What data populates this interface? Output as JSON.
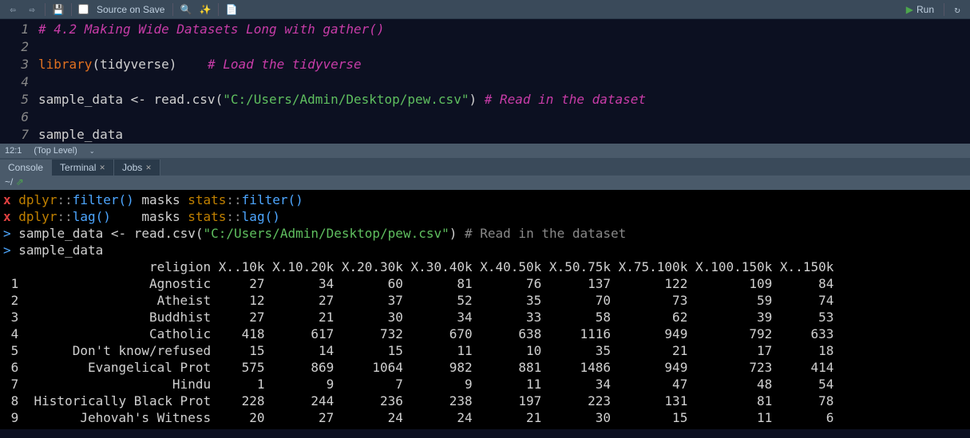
{
  "toolbar": {
    "source_on_save": "Source on Save",
    "run": "Run"
  },
  "editor": {
    "lines": [
      "1",
      "2",
      "3",
      "4",
      "5",
      "6",
      "7"
    ],
    "code": {
      "l1": "# 4.2 Making Wide Datasets Long with gather()",
      "l3_lib": "library",
      "l3_arg": "tidyverse",
      "l3_com": "# Load the tidyverse",
      "l5_var": "sample_data",
      "l5_op": " <- ",
      "l5_fn": "read.csv",
      "l5_str": "\"C:/Users/Admin/Desktop/pew.csv\"",
      "l5_com": "# Read in the dataset",
      "l7": "sample_data"
    }
  },
  "status": {
    "pos": "12:1",
    "scope": "(Top Level)"
  },
  "tabs": {
    "console": "Console",
    "terminal": "Terminal",
    "jobs": "Jobs"
  },
  "console_dir": "~/",
  "console": {
    "m0_pkg1": "dplyr",
    "m0_fn1": "filter()",
    "m0_masks": "masks",
    "m0_pkg2": "stats",
    "m0_fn2": "filter()",
    "m1_pkg1": "dplyr",
    "m1_fn1": "lag()",
    "m1_masks": "masks",
    "m1_pkg2": "stats",
    "m1_fn2": "lag()",
    "prompt": ">",
    "cmd1_var": "sample_data",
    "cmd1_op": " <- ",
    "cmd1_fn": "read.csv",
    "cmd1_str": "\"C:/Users/Admin/Desktop/pew.csv\"",
    "cmd1_com": "# Read in the dataset",
    "cmd2": "sample_data"
  },
  "chart_data": {
    "type": "table",
    "columns": [
      "religion",
      "X..10k",
      "X.10.20k",
      "X.20.30k",
      "X.30.40k",
      "X.40.50k",
      "X.50.75k",
      "X.75.100k",
      "X.100.150k",
      "X..150k"
    ],
    "rows": [
      {
        "n": "1",
        "religion": "Agnostic",
        "v": [
          27,
          34,
          60,
          81,
          76,
          137,
          122,
          109,
          84
        ]
      },
      {
        "n": "2",
        "religion": "Atheist",
        "v": [
          12,
          27,
          37,
          52,
          35,
          70,
          73,
          59,
          74
        ]
      },
      {
        "n": "3",
        "religion": "Buddhist",
        "v": [
          27,
          21,
          30,
          34,
          33,
          58,
          62,
          39,
          53
        ]
      },
      {
        "n": "4",
        "religion": "Catholic",
        "v": [
          418,
          617,
          732,
          670,
          638,
          1116,
          949,
          792,
          633
        ]
      },
      {
        "n": "5",
        "religion": "Don't know/refused",
        "v": [
          15,
          14,
          15,
          11,
          10,
          35,
          21,
          17,
          18
        ]
      },
      {
        "n": "6",
        "religion": "Evangelical Prot",
        "v": [
          575,
          869,
          1064,
          982,
          881,
          1486,
          949,
          723,
          414
        ]
      },
      {
        "n": "7",
        "religion": "Hindu",
        "v": [
          1,
          9,
          7,
          9,
          11,
          34,
          47,
          48,
          54
        ]
      },
      {
        "n": "8",
        "religion": "Historically Black Prot",
        "v": [
          228,
          244,
          236,
          238,
          197,
          223,
          131,
          81,
          78
        ]
      },
      {
        "n": "9",
        "religion": "Jehovah's Witness",
        "v": [
          20,
          27,
          24,
          24,
          21,
          30,
          15,
          11,
          6
        ]
      }
    ]
  }
}
